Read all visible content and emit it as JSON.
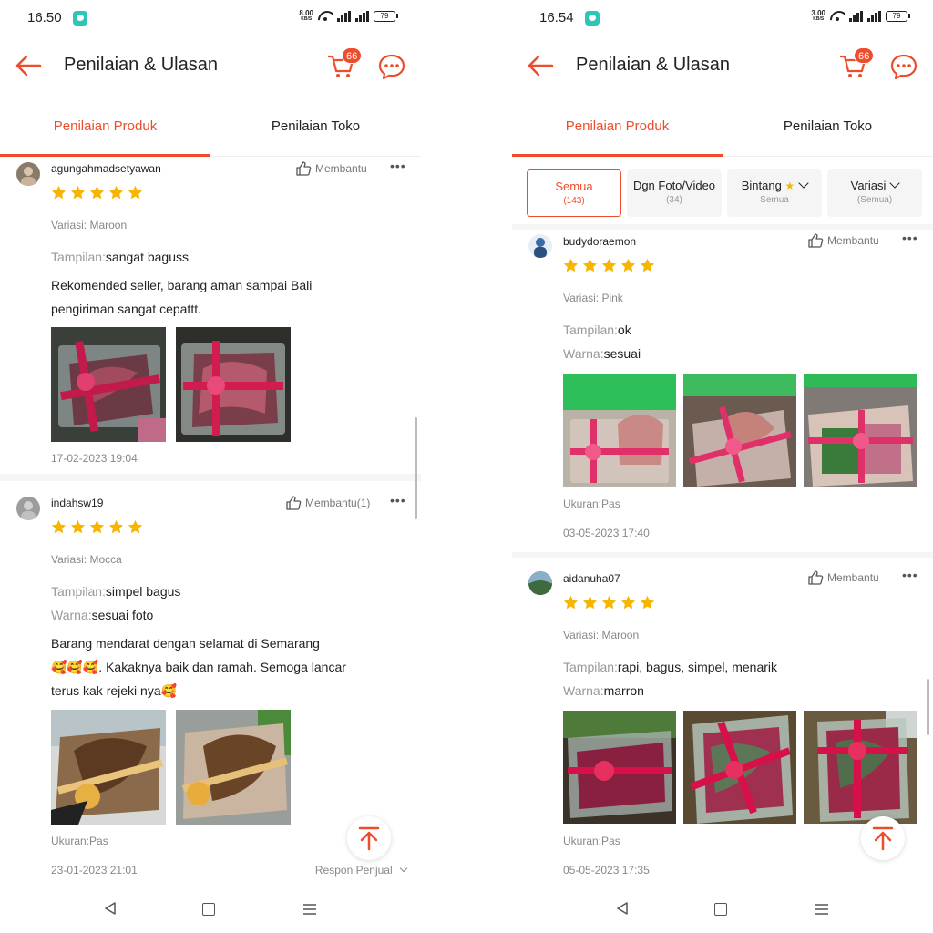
{
  "colors": {
    "accent": "#ee4d2d",
    "star": "#f7b500"
  },
  "left": {
    "status": {
      "time": "16.50",
      "speed": "8.00",
      "speed_unit": "KB/S",
      "battery": "79"
    },
    "appbar": {
      "title": "Penilaian & Ulasan",
      "cart_count": "66"
    },
    "tabs": [
      {
        "label": "Penilaian Produk",
        "active": true
      },
      {
        "label": "Penilaian Toko",
        "active": false
      }
    ],
    "reviews": [
      {
        "user": "agungahmadsetyawan",
        "helpful": "Membantu",
        "stars": 5,
        "variant": "Variasi: Maroon",
        "specs": [
          {
            "key": "Tampilan:",
            "value": "sangat baguss"
          }
        ],
        "text_lines": [
          "Rekomended seller,  barang aman sampai Bali",
          "pengiriman sangat cepattt."
        ],
        "photo_count": 2,
        "date": "17-02-2023 19:04"
      },
      {
        "user": "indahsw19",
        "helpful": "Membantu(1)",
        "stars": 5,
        "variant": "Variasi: Mocca",
        "specs": [
          {
            "key": "Tampilan:",
            "value": "simpel bagus"
          },
          {
            "key": "Warna:",
            "value": "sesuai foto"
          }
        ],
        "text_lines": [
          "Barang mendarat dengan selamat di Semarang",
          "🥰🥰🥰.  Kakaknya baik dan ramah.  Semoga lancar",
          "terus kak rejeki nya🥰"
        ],
        "photo_count": 2,
        "size": "Ukuran:Pas",
        "date": "23-01-2023 21:01",
        "respon": "Respon Penjual"
      }
    ]
  },
  "right": {
    "status": {
      "time": "16.54",
      "speed": "3.00",
      "speed_unit": "KB/S",
      "battery": "79"
    },
    "appbar": {
      "title": "Penilaian & Ulasan",
      "cart_count": "66"
    },
    "tabs": [
      {
        "label": "Penilaian Produk",
        "active": true
      },
      {
        "label": "Penilaian Toko",
        "active": false
      }
    ],
    "filters": [
      {
        "label": "Semua",
        "sub": "(143)",
        "active": true
      },
      {
        "label": "Dgn Foto/Video",
        "sub": "(34)",
        "active": false
      },
      {
        "label": "Bintang",
        "sub": "Semua",
        "active": false
      },
      {
        "label": "Variasi",
        "sub": "(Semua)",
        "active": false
      }
    ],
    "reviews": [
      {
        "user": "budydoraemon",
        "helpful": "Membantu",
        "stars": 5,
        "variant": "Variasi: Pink",
        "specs": [
          {
            "key": "Tampilan:",
            "value": "ok"
          },
          {
            "key": "Warna:",
            "value": "sesuai"
          }
        ],
        "photo_count": 3,
        "size": "Ukuran:Pas",
        "date": "03-05-2023 17:40"
      },
      {
        "user": "aidanuha07",
        "helpful": "Membantu",
        "stars": 5,
        "variant": "Variasi: Maroon",
        "specs": [
          {
            "key": "Tampilan:",
            "value": "rapi, bagus, simpel, menarik"
          },
          {
            "key": "Warna:",
            "value": "marron"
          }
        ],
        "photo_count": 3,
        "size": "Ukuran:Pas",
        "date": "05-05-2023 17:35"
      }
    ]
  }
}
